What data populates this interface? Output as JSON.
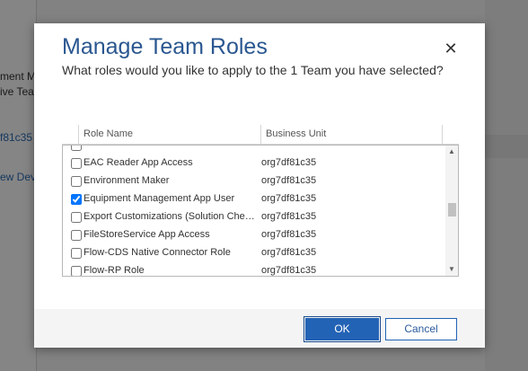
{
  "background": {
    "fragments": [
      "ment M",
      "ive Tea",
      "f81c35",
      "ew Dev"
    ]
  },
  "dialog": {
    "title": "Manage Team Roles",
    "subtitle": "What roles would you like to apply to the 1 Team you have selected?",
    "close_icon": "close-icon",
    "columns": {
      "role_name": "Role Name",
      "business_unit": "Business Unit"
    },
    "rows": [
      {
        "name": "",
        "bu": "",
        "checked": false
      },
      {
        "name": "EAC Reader App Access",
        "bu": "org7df81c35",
        "checked": false
      },
      {
        "name": "Environment Maker",
        "bu": "org7df81c35",
        "checked": false
      },
      {
        "name": "Equipment Management App User",
        "bu": "org7df81c35",
        "checked": true
      },
      {
        "name": "Export Customizations (Solution Check...",
        "bu": "org7df81c35",
        "checked": false
      },
      {
        "name": "FileStoreService App Access",
        "bu": "org7df81c35",
        "checked": false
      },
      {
        "name": "Flow-CDS Native Connector Role",
        "bu": "org7df81c35",
        "checked": false
      },
      {
        "name": "Flow-RP Role",
        "bu": "org7df81c35",
        "checked": false
      }
    ],
    "buttons": {
      "ok": "OK",
      "cancel": "Cancel"
    }
  },
  "colors": {
    "accent": "#2363b5",
    "title": "#2a5790"
  }
}
